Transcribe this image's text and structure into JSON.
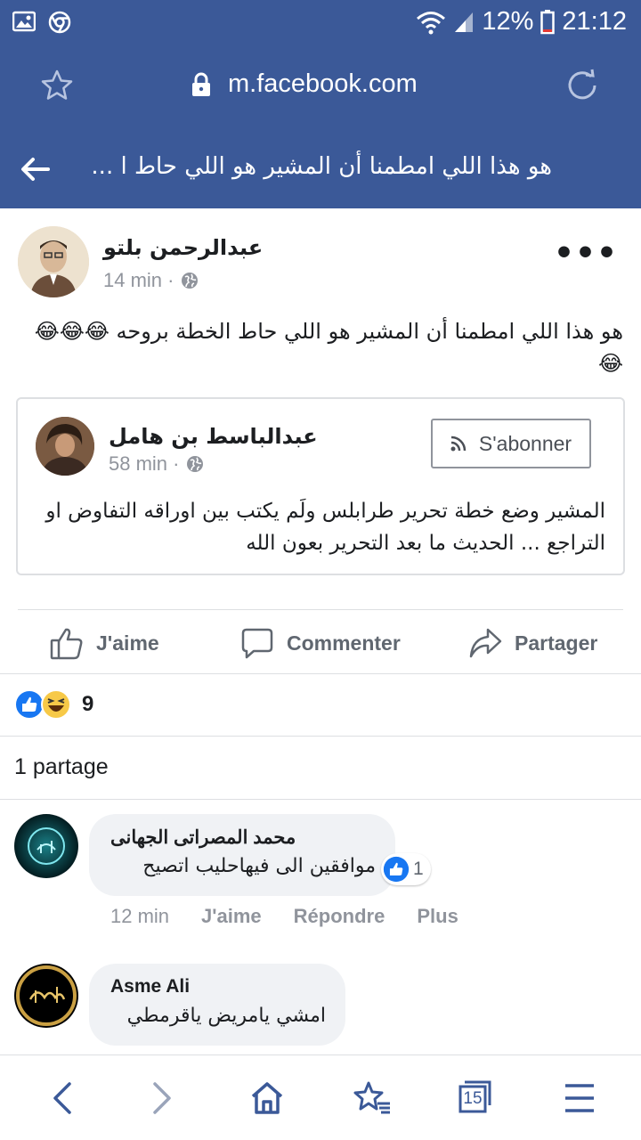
{
  "status_bar": {
    "battery": "12%",
    "time": "21:12"
  },
  "browser": {
    "url": "m.facebook.com"
  },
  "page": {
    "title": "هو هذا اللي امطمنا أن المشير هو اللي حاط ا ..."
  },
  "post": {
    "author": "عبدالرحمن بلتو",
    "time": "14 min ·",
    "text": "هو هذا اللي امطمنا أن المشير هو اللي حاط الخطة بروحه 😂😂😂😂",
    "shared": {
      "author": "عبدالباسط بن هامل",
      "time": "58 min ·",
      "subscribe_label": "S'abonner",
      "text": "المشير وضع خطة تحرير طرابلس ولَم يكتب بين اوراقه التفاوض او التراجع ... الحديث ما بعد التحرير بعون الله"
    },
    "actions": {
      "like": "J'aime",
      "comment": "Commenter",
      "share": "Partager"
    },
    "reactions_count": "9",
    "shares": "1 partage"
  },
  "comments": [
    {
      "name": "محمد المصراتى الجهانى",
      "text": "موافقين الى فيهاحليب اتصيح",
      "likes": "1",
      "time": "12 min",
      "like": "J'aime",
      "reply": "Répondre",
      "more": "Plus"
    },
    {
      "name": "Asme Ali",
      "text": "امشي يامريض ياقرمطي"
    }
  ],
  "bottom_nav": {
    "tabs_count": "15"
  },
  "colors": {
    "brand": "#3b5998",
    "like_blue": "#1877f2",
    "haha_yellow": "#f7c948"
  }
}
